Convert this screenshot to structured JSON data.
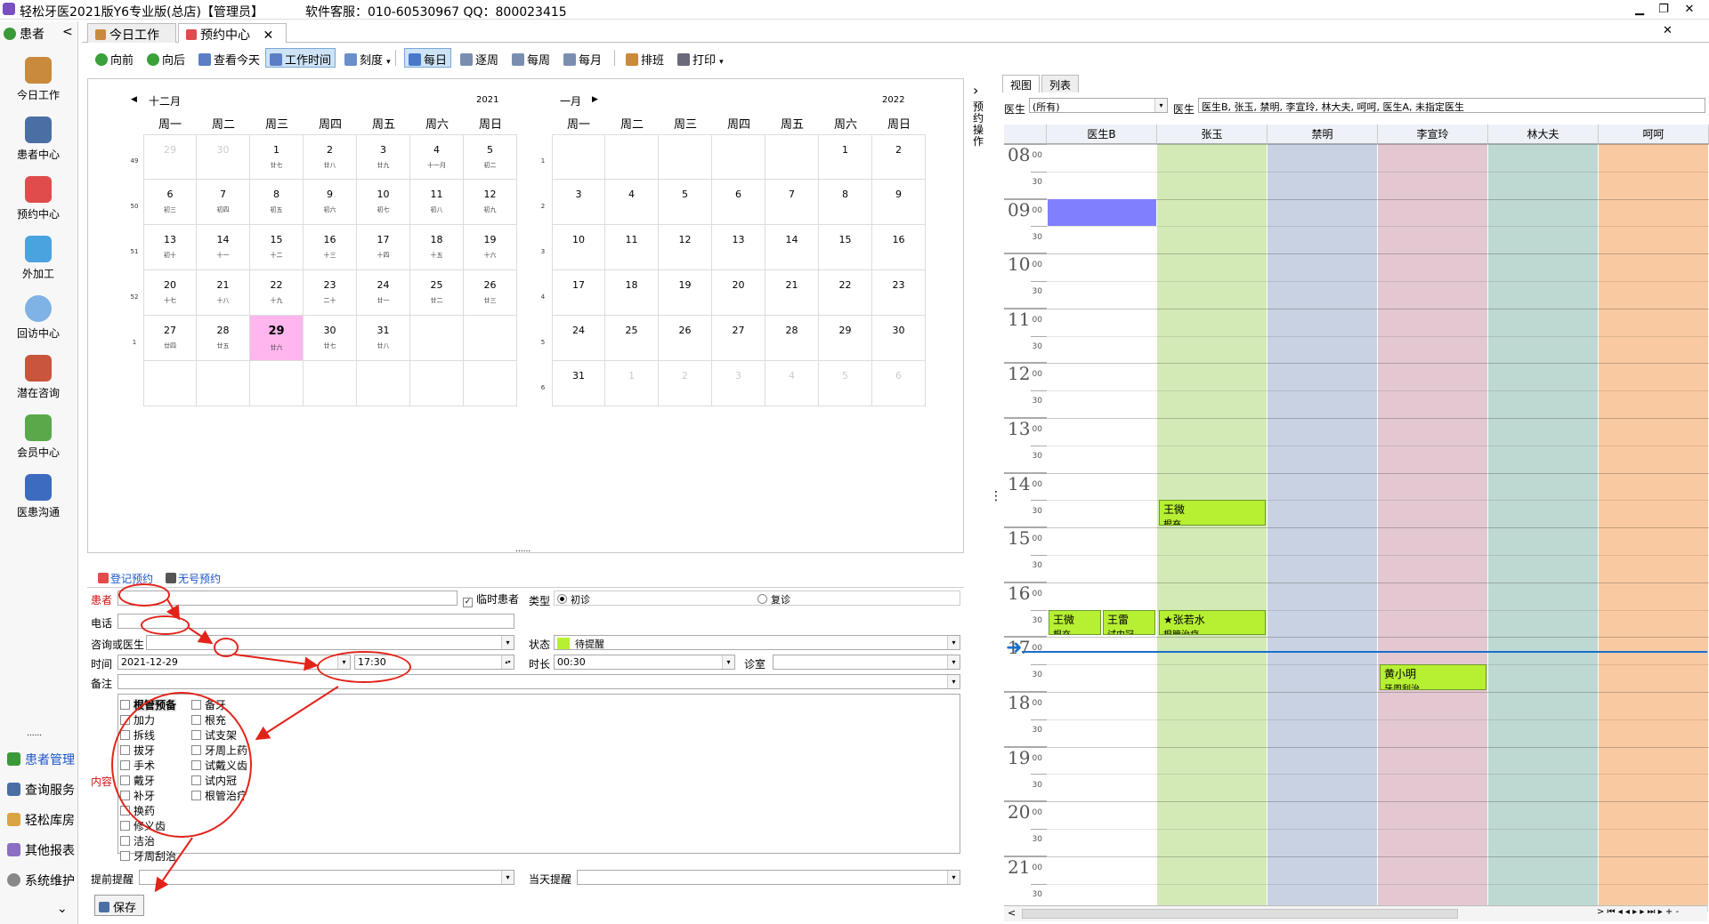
{
  "titlebar": {
    "title": "轻松牙医2021版Y6专业版(总店)【管理员】",
    "service": "软件客服：010-60530967 QQ：800023415",
    "min": "▁",
    "restore": "❐",
    "close": "✕"
  },
  "leftbar": {
    "header": "患者",
    "collapse": "<",
    "items": [
      "今日工作",
      "患者中心",
      "预约中心",
      "外加工",
      "回访中心",
      "潜在咨询",
      "会员中心",
      "医患沟通"
    ],
    "dots": "......",
    "bottom": [
      "患者管理",
      "查询服务",
      "轻松库房",
      "其他报表",
      "系统维护"
    ],
    "more": "⌄"
  },
  "tabs": [
    {
      "label": "今日工作"
    },
    {
      "label": "预约中心",
      "close": "✕"
    }
  ],
  "tabs_close": "✕",
  "toolbar": {
    "items": [
      "向前",
      "向后",
      "查看今天",
      "工作时间",
      "刻度",
      "每日",
      "逐周",
      "每周",
      "每月",
      "排班",
      "打印"
    ],
    "dd": "▾"
  },
  "calendar": {
    "prev": "◀",
    "next": "▶",
    "weekdays": [
      "周一",
      "周二",
      "周三",
      "周四",
      "周五",
      "周六",
      "周日"
    ],
    "months": [
      {
        "name": "十二月",
        "year": "2021",
        "weeks": [
          "49",
          "50",
          "51",
          "52",
          "1",
          ""
        ],
        "days": [
          [
            {
              "d": "29",
              "l": "",
              "o": true
            },
            {
              "d": "30",
              "l": "",
              "o": true
            },
            {
              "d": "1",
              "l": "廿七"
            },
            {
              "d": "2",
              "l": "廿八"
            },
            {
              "d": "3",
              "l": "廿九"
            },
            {
              "d": "4",
              "l": "十一月"
            },
            {
              "d": "5",
              "l": "初二"
            }
          ],
          [
            {
              "d": "6",
              "l": "初三"
            },
            {
              "d": "7",
              "l": "初四"
            },
            {
              "d": "8",
              "l": "初五"
            },
            {
              "d": "9",
              "l": "初六"
            },
            {
              "d": "10",
              "l": "初七"
            },
            {
              "d": "11",
              "l": "初八"
            },
            {
              "d": "12",
              "l": "初九"
            }
          ],
          [
            {
              "d": "13",
              "l": "初十"
            },
            {
              "d": "14",
              "l": "十一"
            },
            {
              "d": "15",
              "l": "十二"
            },
            {
              "d": "16",
              "l": "十三"
            },
            {
              "d": "17",
              "l": "十四"
            },
            {
              "d": "18",
              "l": "十五"
            },
            {
              "d": "19",
              "l": "十六"
            }
          ],
          [
            {
              "d": "20",
              "l": "十七"
            },
            {
              "d": "21",
              "l": "十八"
            },
            {
              "d": "22",
              "l": "十九"
            },
            {
              "d": "23",
              "l": "二十"
            },
            {
              "d": "24",
              "l": "廿一"
            },
            {
              "d": "25",
              "l": "廿二"
            },
            {
              "d": "26",
              "l": "廿三"
            }
          ],
          [
            {
              "d": "27",
              "l": "廿四"
            },
            {
              "d": "28",
              "l": "廿五"
            },
            {
              "d": "29",
              "l": "廿六",
              "t": true
            },
            {
              "d": "30",
              "l": "廿七"
            },
            {
              "d": "31",
              "l": "廿八"
            },
            {
              "d": "",
              "l": ""
            },
            {
              "d": "",
              "l": ""
            }
          ],
          [
            {
              "d": "",
              "l": ""
            },
            {
              "d": "",
              "l": ""
            },
            {
              "d": "",
              "l": ""
            },
            {
              "d": "",
              "l": ""
            },
            {
              "d": "",
              "l": ""
            },
            {
              "d": "",
              "l": ""
            },
            {
              "d": "",
              "l": ""
            }
          ]
        ]
      },
      {
        "name": "一月",
        "year": "2022",
        "weeks": [
          "1",
          "2",
          "3",
          "4",
          "5",
          "6"
        ],
        "days": [
          [
            {
              "d": "",
              "l": ""
            },
            {
              "d": "",
              "l": ""
            },
            {
              "d": "",
              "l": ""
            },
            {
              "d": "",
              "l": ""
            },
            {
              "d": "",
              "l": ""
            },
            {
              "d": "1",
              "l": ""
            },
            {
              "d": "2",
              "l": ""
            }
          ],
          [
            {
              "d": "3",
              "l": ""
            },
            {
              "d": "4",
              "l": ""
            },
            {
              "d": "5",
              "l": ""
            },
            {
              "d": "6",
              "l": ""
            },
            {
              "d": "7",
              "l": ""
            },
            {
              "d": "8",
              "l": ""
            },
            {
              "d": "9",
              "l": ""
            }
          ],
          [
            {
              "d": "10",
              "l": ""
            },
            {
              "d": "11",
              "l": ""
            },
            {
              "d": "12",
              "l": ""
            },
            {
              "d": "13",
              "l": ""
            },
            {
              "d": "14",
              "l": ""
            },
            {
              "d": "15",
              "l": ""
            },
            {
              "d": "16",
              "l": ""
            }
          ],
          [
            {
              "d": "17",
              "l": ""
            },
            {
              "d": "18",
              "l": ""
            },
            {
              "d": "19",
              "l": ""
            },
            {
              "d": "20",
              "l": ""
            },
            {
              "d": "21",
              "l": ""
            },
            {
              "d": "22",
              "l": ""
            },
            {
              "d": "23",
              "l": ""
            }
          ],
          [
            {
              "d": "24",
              "l": ""
            },
            {
              "d": "25",
              "l": ""
            },
            {
              "d": "26",
              "l": ""
            },
            {
              "d": "27",
              "l": ""
            },
            {
              "d": "28",
              "l": ""
            },
            {
              "d": "29",
              "l": ""
            },
            {
              "d": "30",
              "l": ""
            }
          ],
          [
            {
              "d": "31",
              "l": ""
            },
            {
              "d": "1",
              "l": "",
              "o": true
            },
            {
              "d": "2",
              "l": "",
              "o": true
            },
            {
              "d": "3",
              "l": "",
              "o": true
            },
            {
              "d": "4",
              "l": "",
              "o": true
            },
            {
              "d": "5",
              "l": "",
              "o": true
            },
            {
              "d": "6",
              "l": "",
              "o": true
            }
          ]
        ]
      }
    ]
  },
  "splitter": {
    "arrow": "›",
    "label": "预约操作",
    "handle": "⋮",
    "dots": "......"
  },
  "form": {
    "tab_register": "登记预约",
    "tab_nonumber": "无号预约",
    "patient_label": "患者",
    "patient_value": "",
    "temp_patient": "临时患者",
    "type_label": "类型",
    "type_first": "初诊",
    "type_revisit": "复诊",
    "phone_label": "电话",
    "phone_value": "",
    "doctor_label": "咨询或医生",
    "doctor_value": "",
    "status_label": "状态",
    "status_value": "待提醒",
    "status_color": "#b7f032",
    "time_label": "时间",
    "date_value": "2021-12-29",
    "time_value": "17:30",
    "duration_label": "时长",
    "duration_value": "00:30",
    "room_label": "诊室",
    "room_value": "",
    "note_label": "备注",
    "note_value": "",
    "content_label": "内容",
    "content_col1": [
      "根管预备",
      "加力",
      "拆线",
      "拔牙",
      "手术",
      "戴牙",
      "补牙",
      "换药",
      "修义齿",
      "洁治",
      "牙周刮治"
    ],
    "content_col2": [
      "备牙",
      "根充",
      "试支架",
      "牙周上药",
      "试戴义齿",
      "试内冠",
      "根管治疗"
    ],
    "remind_label": "提前提醒",
    "remind_value": "",
    "today_remind_label": "当天提醒",
    "today_remind_value": "",
    "save_label": "保存",
    "dd": "▾",
    "spin": "▴▾"
  },
  "schedule": {
    "tab_view": "视图",
    "tab_list": "列表",
    "doctor_label": "医生",
    "doctor_filter": "(所有)",
    "doctor_label2": "医生",
    "doctor_list": "医生B, 张玉, 禁明, 李宣玲, 林大夫, 呵呵, 医生A, 未指定医生",
    "dd": "▾",
    "columns": [
      {
        "name": "医生B",
        "color": "#ffffff"
      },
      {
        "name": "张玉",
        "color": "#d4eab6"
      },
      {
        "name": "禁明",
        "color": "#c9d2e2"
      },
      {
        "name": "李宣玲",
        "color": "#e3c8d2"
      },
      {
        "name": "林大夫",
        "color": "#bed8d2"
      },
      {
        "name": "呵呵",
        "color": "#f9caa2"
      }
    ],
    "hours": [
      "08",
      "09",
      "10",
      "11",
      "12",
      "13",
      "14",
      "15",
      "16",
      "17",
      "18",
      "19",
      "20",
      "21"
    ],
    "min00": "00",
    "min30": "30",
    "block_color": "#8080ff",
    "now_arrow": "➜",
    "now_line_color": "#1a6fc9",
    "appointments": [
      {
        "name": "王微",
        "detail": "根充",
        "doctor": 1,
        "start": 14.5,
        "dur": 0.5
      },
      {
        "name": "王微",
        "detail": "根充",
        "doctor": 0,
        "start": 16.5,
        "dur": 0.5,
        "part": 0
      },
      {
        "name": "王雷",
        "detail": "试内冠",
        "doctor": 0,
        "start": 16.5,
        "dur": 0.5,
        "part": 1
      },
      {
        "name": "★张若水",
        "detail": "根管治疗",
        "doctor": 1,
        "start": 16.5,
        "dur": 0.5
      },
      {
        "name": "黄小明",
        "detail": "牙周刮治",
        "doctor": 3,
        "start": 17.5,
        "dur": 0.5
      }
    ],
    "scroll_left": "<",
    "scroll_controls": ">  ⏮  ◂  ◂  ▸  ▸  ⏭  ▸  +  -"
  }
}
